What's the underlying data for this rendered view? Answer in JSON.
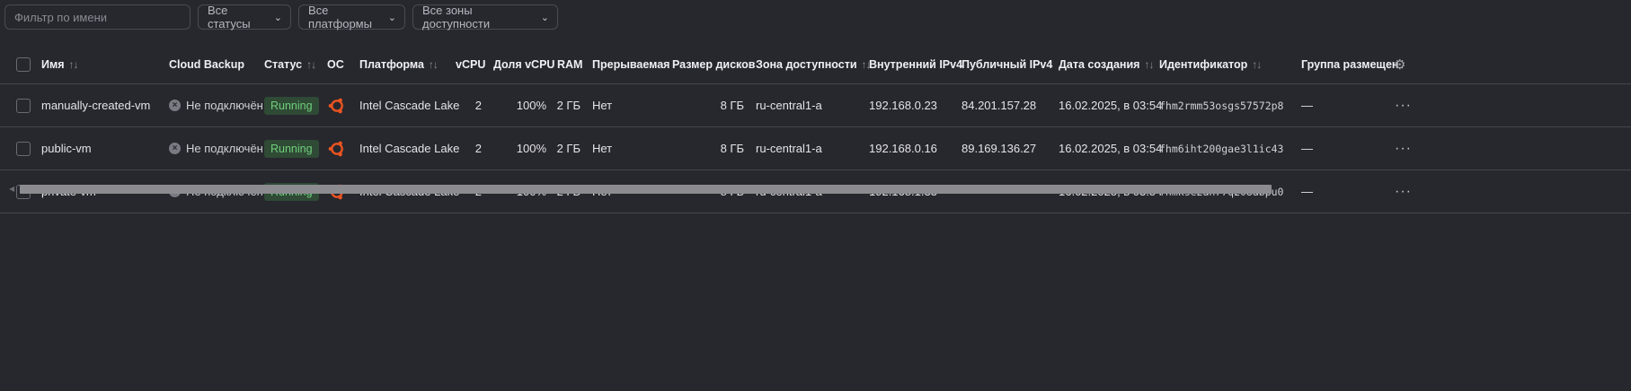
{
  "filters": {
    "name_placeholder": "Фильтр по имени",
    "status": "Все статусы",
    "platform": "Все платформы",
    "zone": "Все зоны доступности",
    "chevron_icon": "chevron-down-icon"
  },
  "table": {
    "headers": {
      "name": "Имя",
      "backup": "Cloud Backup",
      "status": "Статус",
      "os": "ОС",
      "platform": "Платформа",
      "vcpu": "vCPU",
      "vcpu_share": "Доля vCPU",
      "ram": "RAM",
      "preemptible": "Прерываемая",
      "disk": "Размер дисков",
      "zone": "Зона доступности",
      "ipv4_internal": "Внутренний IPv4",
      "ipv4_public": "Публичный IPv4",
      "created": "Дата создания",
      "id": "Идентификатор",
      "placement": "Группа размещен"
    },
    "sort_glyph": "↑↓",
    "rows": [
      {
        "name": "manually-created-vm",
        "backup": "Не подключён",
        "status": "Running",
        "os_icon": "ubuntu-icon",
        "platform": "Intel Cascade Lake",
        "vcpu": "2",
        "vcpu_share": "100%",
        "ram": "2 ГБ",
        "preemptible": "Нет",
        "disk": "8 ГБ",
        "zone": "ru-central1-a",
        "ipv4_internal": "192.168.0.23",
        "ipv4_public": "84.201.157.28",
        "created": "16.02.2025, в 03:54",
        "id": "fhm2rmm53osgs57572p8",
        "placement": "—",
        "actions": "···"
      },
      {
        "name": "public-vm",
        "backup": "Не подключён",
        "status": "Running",
        "os_icon": "ubuntu-icon",
        "platform": "Intel Cascade Lake",
        "vcpu": "2",
        "vcpu_share": "100%",
        "ram": "2 ГБ",
        "preemptible": "Нет",
        "disk": "8 ГБ",
        "zone": "ru-central1-a",
        "ipv4_internal": "192.168.0.16",
        "ipv4_public": "89.169.136.27",
        "created": "16.02.2025, в 03:54",
        "id": "fhm6iht200gae3l1ic43",
        "placement": "—",
        "actions": "···"
      },
      {
        "name": "private-vm",
        "backup": "Не подключён",
        "status": "Running",
        "os_icon": "ubuntu-icon",
        "platform": "Intel Cascade Lake",
        "vcpu": "2",
        "vcpu_share": "100%",
        "ram": "2 ГБ",
        "preemptible": "Нет",
        "disk": "8 ГБ",
        "zone": "ru-central1-a",
        "ipv4_internal": "192.168.1.33",
        "ipv4_public": "—",
        "created": "16.02.2025, в 03:54",
        "id": "fhmkse2ah77q208abpu0",
        "placement": "—",
        "actions": "···"
      }
    ]
  },
  "colors": {
    "background": "#27272e",
    "status_running_bg": "#2f4a35",
    "status_running_text": "#6fcf7c",
    "ubuntu_orange": "#e95420"
  }
}
